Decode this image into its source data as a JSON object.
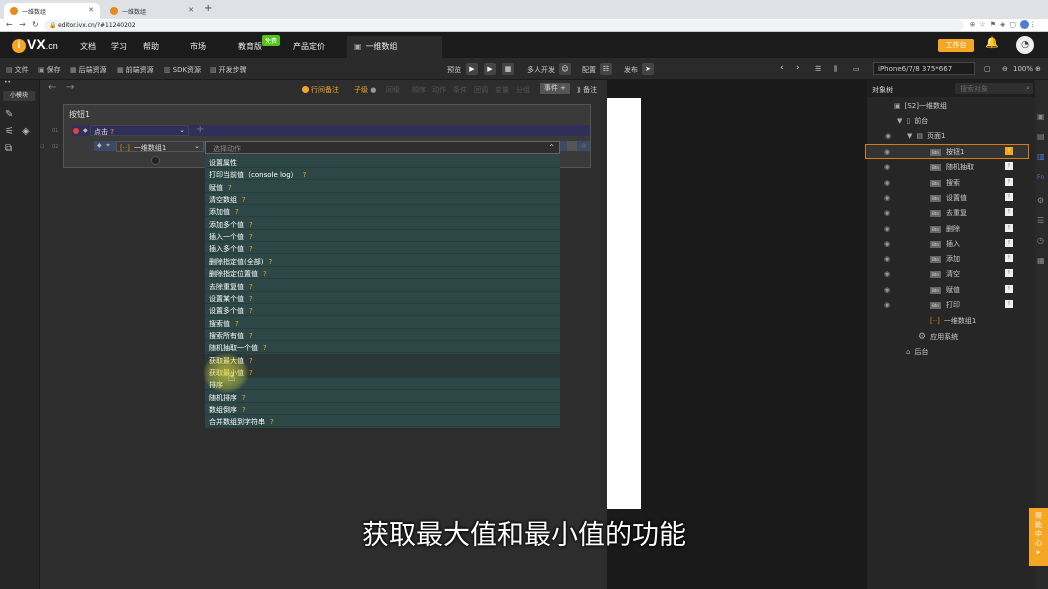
{
  "browser": {
    "tabs": [
      {
        "label": "一维数组"
      },
      {
        "label": "一维数组"
      }
    ],
    "url": "editor.ivx.cn/?#11240202"
  },
  "header": {
    "logo_mark": "i",
    "logo_text": "VX",
    "logo_suffix": ".cn",
    "menu": [
      "文档",
      "学习",
      "帮助",
      "市场",
      "教育版",
      "产品定价"
    ],
    "free_badge": "免费",
    "active_tab": "一维数组",
    "workbench": "工作台"
  },
  "toolbar": {
    "left": [
      "文件",
      "保存",
      "后端资源",
      "前端资源",
      "SDK资源",
      "开发步骤"
    ],
    "preview": "预览",
    "multi_dev": "多人开发",
    "config": "配置",
    "publish": "发布",
    "device": "iPhone6/7/8 375*667",
    "zoom": "100%"
  },
  "left_strip": {
    "module_btn": "小模块"
  },
  "sub_toolbar": {
    "items": [
      "行间备注",
      "子级",
      "同级",
      "顺序",
      "动作",
      "条件",
      "回调",
      "变量",
      "分组"
    ],
    "event_btn": "事件",
    "note": "备注"
  },
  "panel": {
    "title": "按钮1",
    "event_label": "点击",
    "target_label": "一维数组1",
    "action_placeholder": "选择动作",
    "line_nums": [
      "01",
      "02"
    ]
  },
  "dropdown": {
    "options": [
      {
        "label": "设置属性",
        "help": ""
      },
      {
        "label": "打印当前值（console log）",
        "help": "?"
      },
      {
        "label": "赋值",
        "help": "?"
      },
      {
        "label": "清空数组",
        "help": "?"
      },
      {
        "label": "添加值",
        "help": "?"
      },
      {
        "label": "添加多个值",
        "help": "?"
      },
      {
        "label": "插入一个值",
        "help": "?"
      },
      {
        "label": "插入多个值",
        "help": "?"
      },
      {
        "label": "删除指定值(全部)",
        "help": "?"
      },
      {
        "label": "删除指定位置值",
        "help": "?"
      },
      {
        "label": "去除重复值",
        "help": "?"
      },
      {
        "label": "设置某个值",
        "help": "?"
      },
      {
        "label": "设置多个值",
        "help": "?"
      },
      {
        "label": "搜索值",
        "help": "?"
      },
      {
        "label": "搜索所有值",
        "help": "?"
      },
      {
        "label": "随机抽取一个值",
        "help": "?"
      },
      {
        "label": "获取最大值",
        "help": "?"
      },
      {
        "label": "获取最小值",
        "help": "?"
      },
      {
        "label": "排序",
        "help": ""
      },
      {
        "label": "随机排序",
        "help": "?"
      },
      {
        "label": "数组倒序",
        "help": "?"
      },
      {
        "label": "合并数组到字符串",
        "help": "?"
      }
    ]
  },
  "object_tree": {
    "tab": "对象树",
    "search_placeholder": "搜索对象",
    "root": "[S2]一维数组",
    "front": "前台",
    "page": "页面1",
    "components": [
      "按钮1",
      "随机抽取",
      "搜索",
      "设置值",
      "去重复",
      "删除",
      "插入",
      "添加",
      "清空",
      "赋值",
      "打印"
    ],
    "array": "一维数组1",
    "app_system": "应用系统",
    "backend": "后台"
  },
  "help_center": "帮助中心",
  "subtitle": "获取最大值和最小值的功能"
}
